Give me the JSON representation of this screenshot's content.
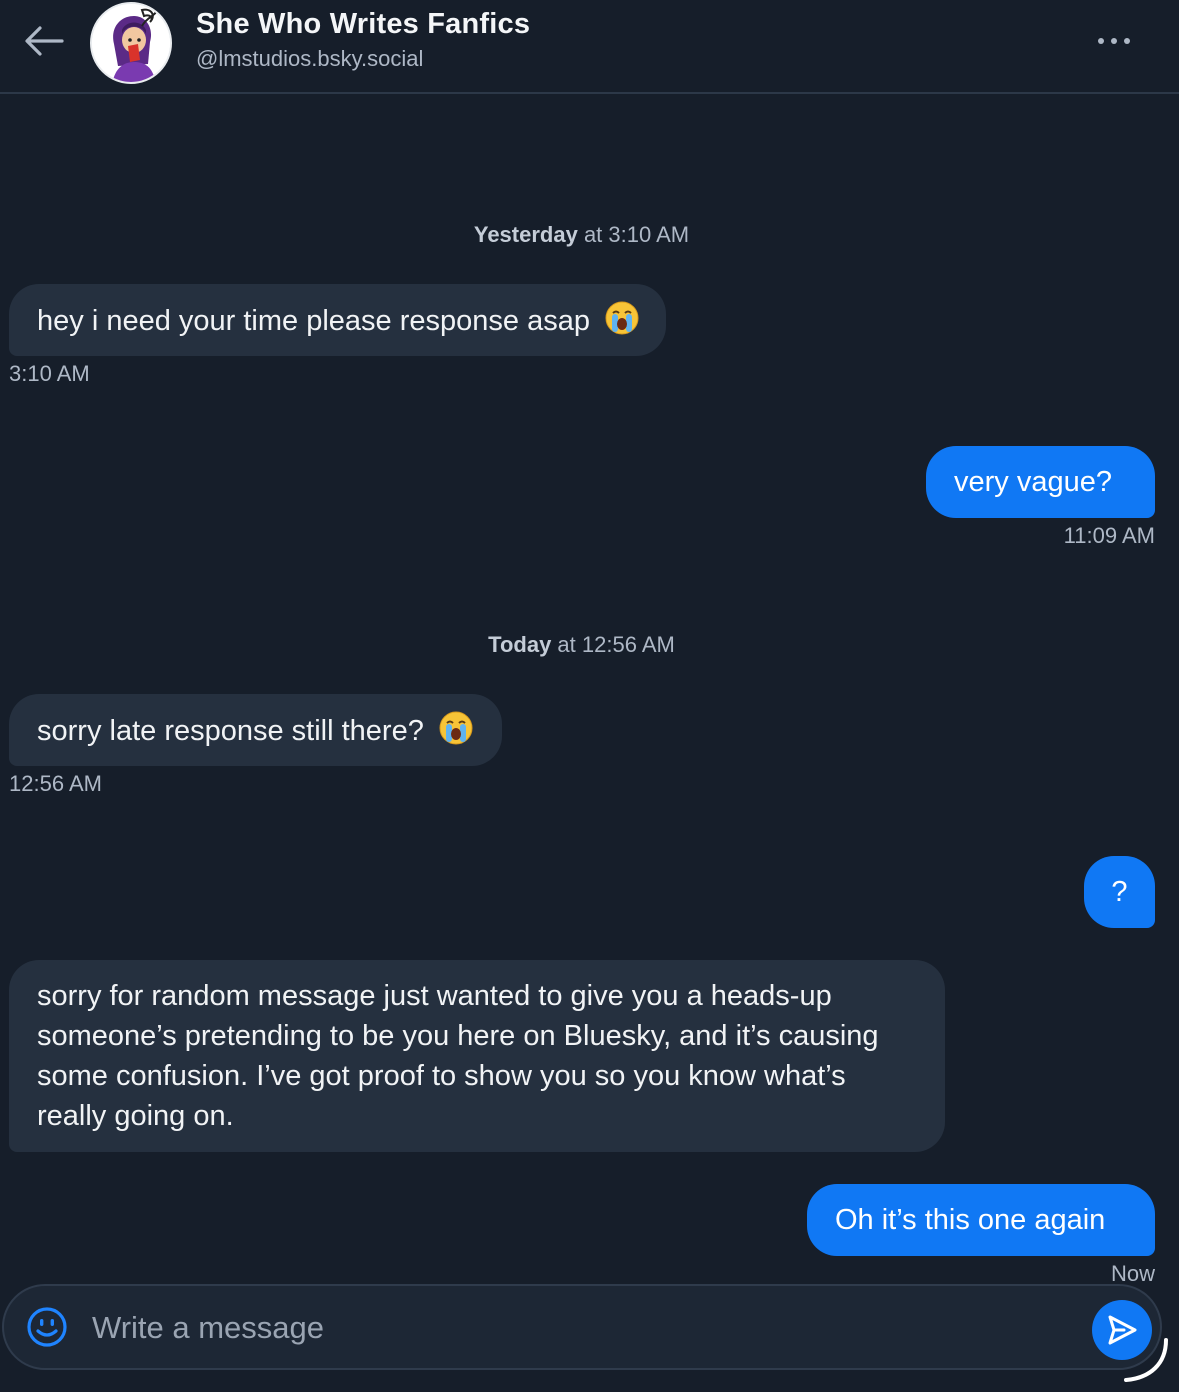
{
  "header": {
    "title": "She Who Writes Fanfics",
    "handle": "@lmstudios.bsky.social",
    "back_icon": "arrow-left-icon",
    "more_icon": "ellipsis-icon"
  },
  "dividers": [
    {
      "day": "Yesterday",
      "rest": " at 3:10 AM"
    },
    {
      "day": "Today",
      "rest": " at 12:56 AM"
    }
  ],
  "messages": [
    {
      "from": "them",
      "text": "hey i need your time please response asap",
      "emoji": "loudly-crying-face",
      "time": "3:10 AM"
    },
    {
      "from": "me",
      "text": "very vague?",
      "time": "11:09 AM"
    },
    {
      "from": "them",
      "text": "sorry late response still there?",
      "emoji": "loudly-crying-face",
      "time": "12:56 AM"
    },
    {
      "from": "me",
      "text": "?",
      "time": ""
    },
    {
      "from": "them",
      "text": "sorry for random message just wanted to give you a heads-up someone’s pretending to be you here on Bluesky, and it’s causing some confusion. I’ve got proof to show you so you know what’s really going on.",
      "time": ""
    },
    {
      "from": "me",
      "text": "Oh it’s this one again",
      "time": "Now"
    }
  ],
  "composer": {
    "placeholder": "Write a message",
    "value": "",
    "emoji_icon": "smiley-icon",
    "send_icon": "send-icon"
  },
  "colors": {
    "background": "#161e2a",
    "incoming_bubble": "#25303f",
    "outgoing_bubble": "#1078f4",
    "muted_text": "#aeb8c6"
  }
}
